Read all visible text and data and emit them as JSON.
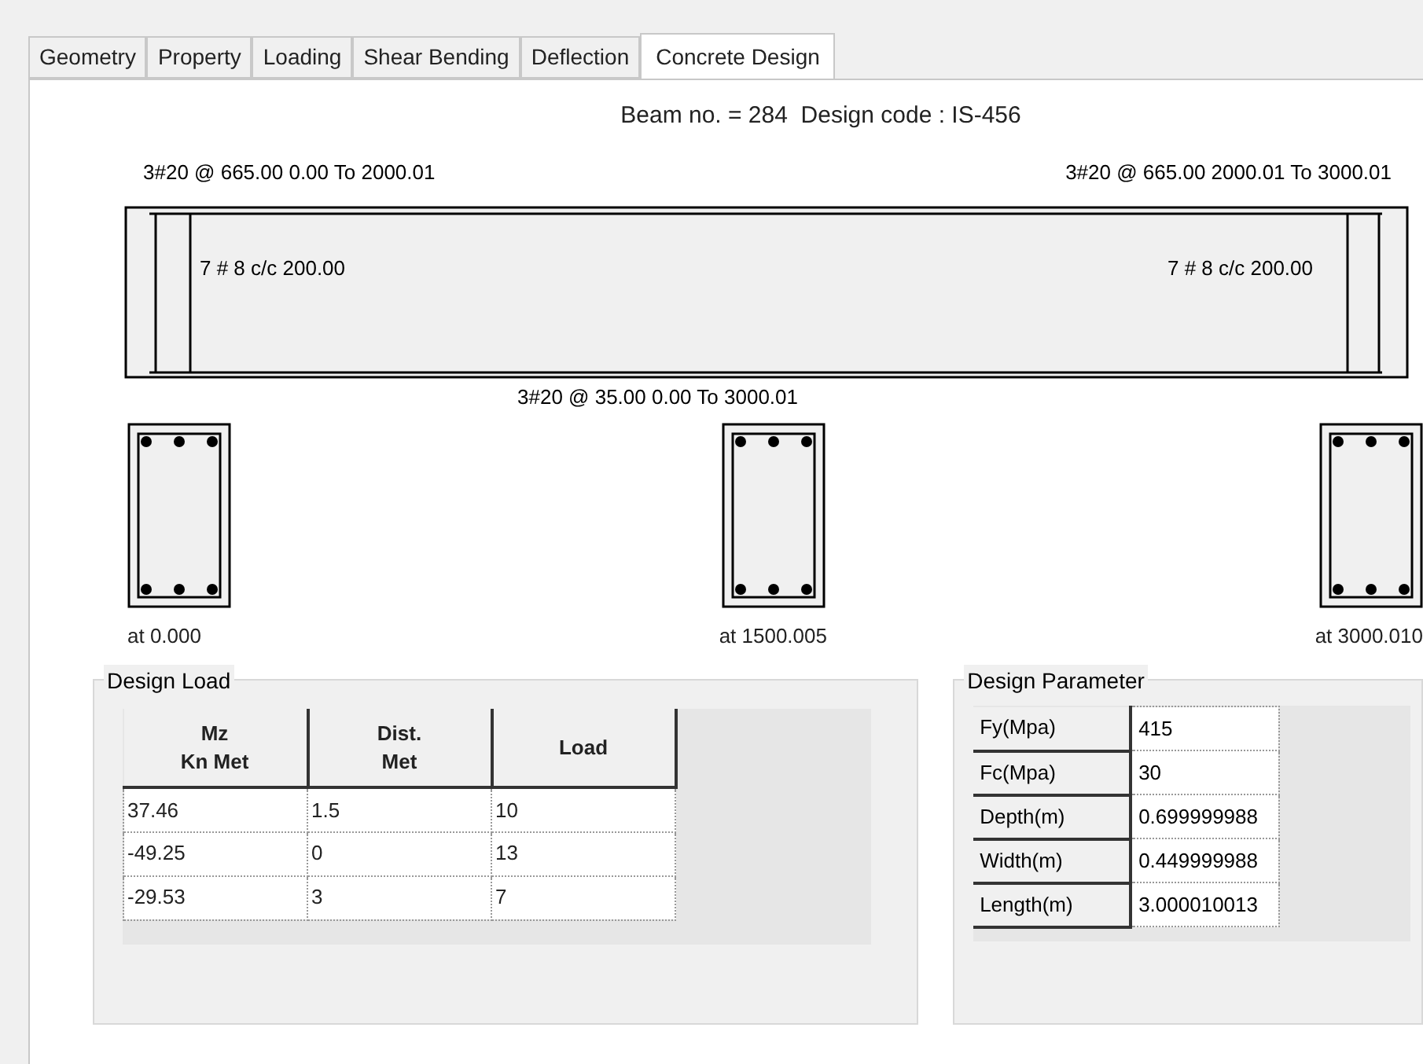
{
  "tabs": [
    {
      "label": "Geometry",
      "selected": false
    },
    {
      "label": "Property",
      "selected": false
    },
    {
      "label": "Loading",
      "selected": false
    },
    {
      "label": "Shear Bending",
      "selected": false
    },
    {
      "label": "Deflection",
      "selected": false
    },
    {
      "label": "Concrete Design",
      "selected": true
    }
  ],
  "heading": "Beam no. = 284  Design code : IS-456",
  "top_bars": [
    "3#20 @ 665.00 0.00 To 2000.01",
    "3#20 @ 665.00 2000.01 To 3000.01"
  ],
  "stirrups": [
    "7 # 8 c/c 200.00",
    "7 # 8 c/c 200.00"
  ],
  "bottom_bar": "3#20 @ 35.00 0.00 To 3000.01",
  "sections": [
    "at 0.000",
    "at 1500.005",
    "at 3000.010"
  ],
  "design_load": {
    "title": "Design Load",
    "columns": [
      "Mz\nKn Met",
      "Dist.\nMet",
      "Load"
    ],
    "rows": [
      [
        "37.46",
        "1.5",
        "10"
      ],
      [
        "-49.25",
        "0",
        "13"
      ],
      [
        "-29.53",
        "3",
        "7"
      ]
    ]
  },
  "design_parameter": {
    "title": "Design Parameter",
    "rows": [
      {
        "label": "Fy(Mpa)",
        "value": "415"
      },
      {
        "label": "Fc(Mpa)",
        "value": "30"
      },
      {
        "label": "Depth(m)",
        "value": "0.699999988"
      },
      {
        "label": "Width(m)",
        "value": "0.449999988"
      },
      {
        "label": "Length(m)",
        "value": "3.000010013"
      }
    ]
  }
}
